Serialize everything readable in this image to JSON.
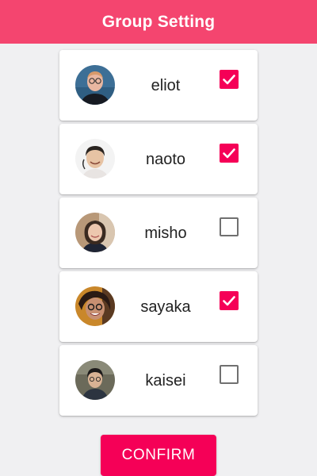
{
  "header": {
    "title": "Group Setting",
    "background": "#f4456f"
  },
  "members": [
    {
      "name": "eliot",
      "checked": true,
      "avatar_icon": "user-avatar-photo"
    },
    {
      "name": "naoto",
      "checked": true,
      "avatar_icon": "user-avatar-photo"
    },
    {
      "name": "misho",
      "checked": false,
      "avatar_icon": "user-avatar-photo"
    },
    {
      "name": "sayaka",
      "checked": true,
      "avatar_icon": "user-avatar-photo"
    },
    {
      "name": "kaisei",
      "checked": false,
      "avatar_icon": "user-avatar-photo"
    }
  ],
  "confirm": {
    "label": "CONFIRM"
  },
  "colors": {
    "accent": "#f50057",
    "background": "#f0f0f2",
    "unchecked_border": "#707070"
  }
}
